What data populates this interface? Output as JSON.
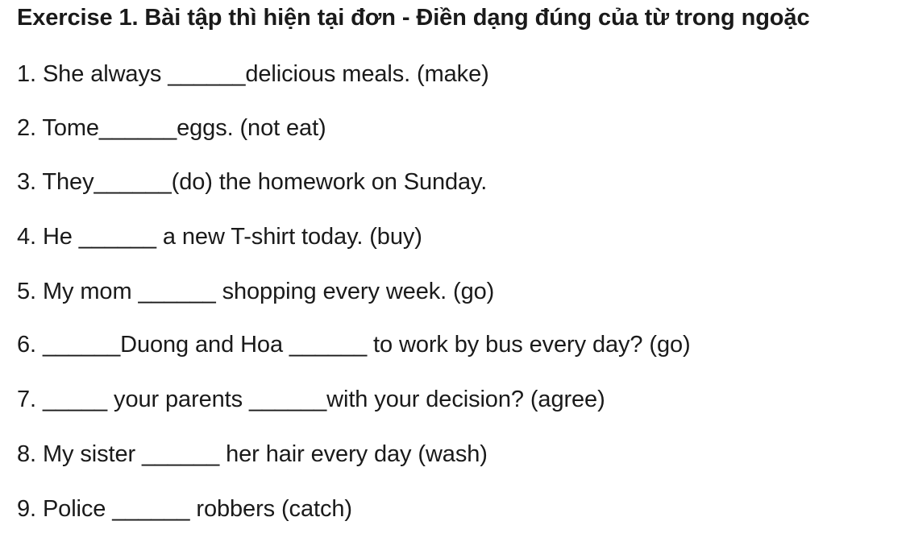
{
  "worksheet": {
    "title": "Exercise 1. Bài tập thì hiện tại đơn - Điền dạng đúng của từ trong ngoặc",
    "questions": [
      "1. She always ______delicious meals. (make)",
      "2. Tome______eggs. (not eat)",
      "3. They______(do) the homework on Sunday.",
      "4. He ______ a new T-shirt today. (buy)",
      "5. My mom ______ shopping every week. (go)",
      "6. ______Duong and Hoa ______ to work by bus every day? (go)",
      "7. _____ your parents ______with your decision? (agree)",
      "8. My sister ______ her hair every day (wash)",
      "9. Police ______ robbers (catch)"
    ]
  }
}
